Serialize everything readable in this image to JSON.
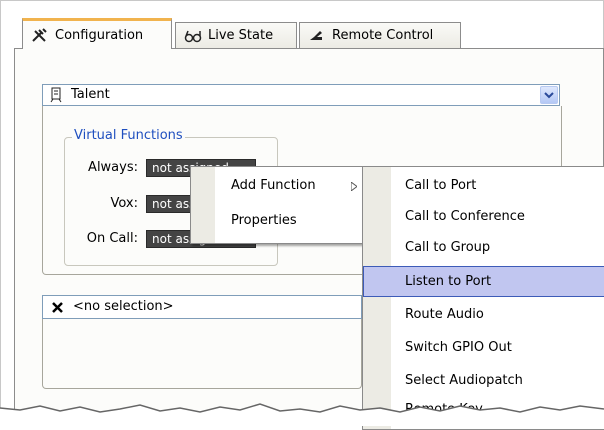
{
  "tabs": [
    {
      "label": "Configuration",
      "icon": "tools-icon"
    },
    {
      "label": "Live State",
      "icon": "glasses-icon"
    },
    {
      "label": "Remote Control",
      "icon": "remote-icon"
    }
  ],
  "talent_combo": {
    "value": "Talent",
    "icon": "panel-icon"
  },
  "virtual_functions": {
    "legend": "Virtual Functions",
    "rows": [
      {
        "label": "Always:",
        "value": "not assigned"
      },
      {
        "label": "Vox:",
        "value": "not assigned"
      },
      {
        "label": "On Call:",
        "value": "not assigned"
      }
    ]
  },
  "selection": {
    "text": "<no selection>",
    "icon": "x-icon"
  },
  "context_menu": {
    "items": [
      {
        "label": "Add Function",
        "has_submenu": true
      },
      {
        "label": "Properties",
        "has_submenu": false
      }
    ]
  },
  "submenu": {
    "items": [
      {
        "label": "Call to Port"
      },
      {
        "label": "Call to Conference"
      },
      {
        "label": "Call to Group"
      },
      {
        "label": "Listen to Port",
        "highlighted": true
      },
      {
        "label": "Route Audio"
      },
      {
        "label": "Switch GPIO Out"
      },
      {
        "label": "Select Audiopatch"
      },
      {
        "label": "Remote Key"
      }
    ]
  },
  "colors": {
    "tab_accent": "#f1b34e",
    "legend": "#1f4fbf",
    "highlight": "#c1c6f0"
  }
}
